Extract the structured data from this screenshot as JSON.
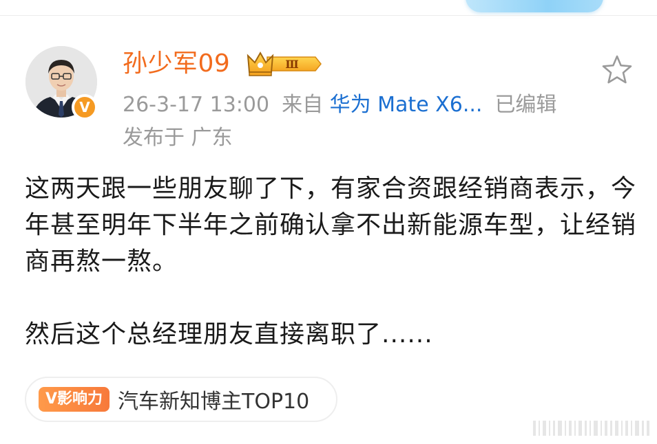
{
  "post": {
    "author": {
      "name": "孙少军09",
      "level_badge": "Ⅲ",
      "verified_mark": "V"
    },
    "meta": {
      "timestamp": "26-3-17 13:00",
      "from_label": "来自",
      "device": "华为 Mate X6...",
      "edited": "已编辑",
      "location": "发布于 广东"
    },
    "content": {
      "paragraph_1": "这两天跟一些朋友聊了下，有家合资跟经销商表示，今年甚至明年下半年之前确认拿不出新能源车型，让经销商再熬一熬。",
      "paragraph_2": "然后这个总经理朋友直接离职了......"
    },
    "influence_tag": {
      "badge": "V影响力",
      "label": "汽车新知博主TOP10"
    }
  },
  "colors": {
    "username": "#f26b1d",
    "source_link": "#1b6fd1",
    "meta_gray": "#9a9a9a",
    "verified": "#f59a23",
    "influence_badge": "#f7793a"
  },
  "icons": {
    "favorite": "star-outline-icon",
    "crown": "crown-icon",
    "watermark": "weibo-watermark"
  }
}
